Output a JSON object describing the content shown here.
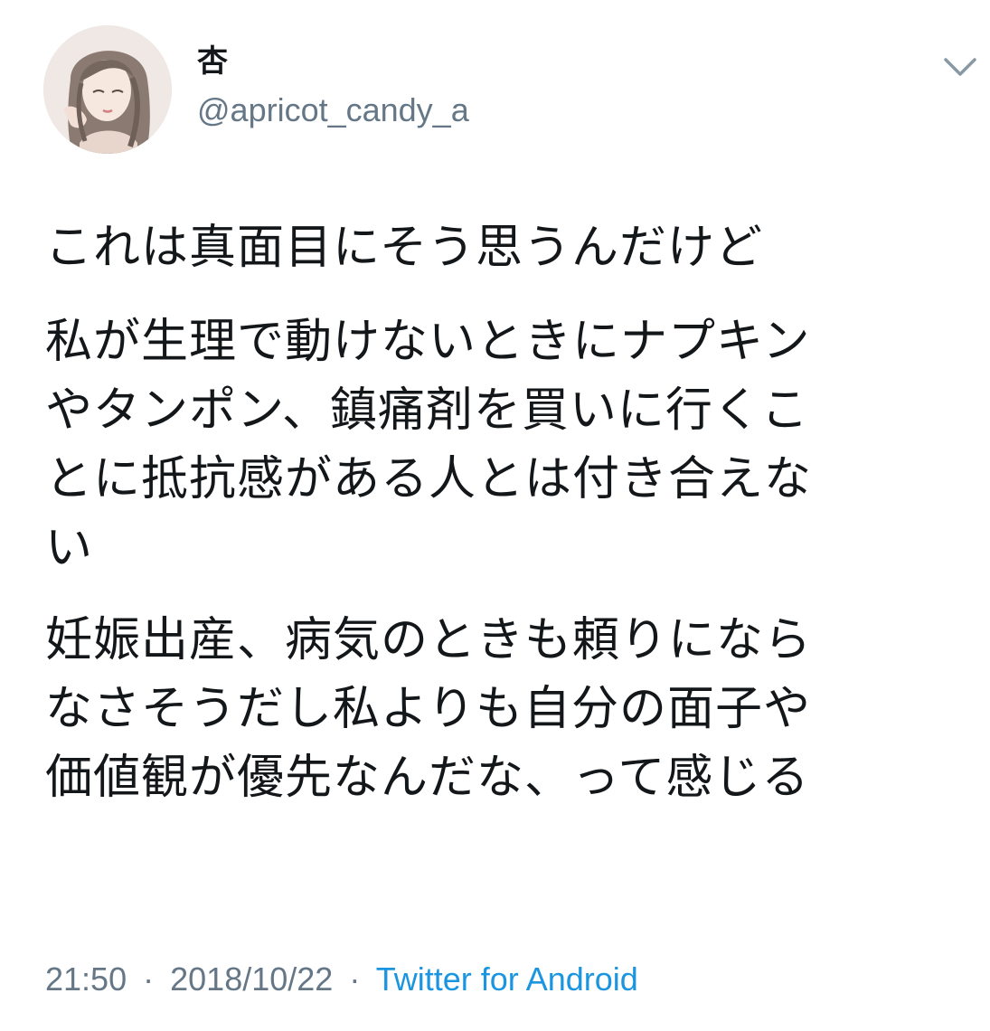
{
  "tweet": {
    "author": {
      "display_name": "杏",
      "handle": "@apricot_candy_a",
      "avatar_icon": "illustrated-girl-avatar"
    },
    "menu_icon": "chevron-down-icon",
    "body": [
      "これは真面目にそう思うんだけど",
      "私が生理で動けないときにナプキン\nやタンポン、鎮痛剤を買いに行くこ\nとに抵抗感がある人とは付き合えな\nい",
      "妊娠出産、病気のときも頼りになら\nなさそうだし私よりも自分の面子や\n価値観が優先なんだな、って感じる"
    ],
    "time": "21:50",
    "date": "2018/10/22",
    "separator": "·",
    "source": "Twitter for Android",
    "colors": {
      "text": "#14171a",
      "secondary": "#657786",
      "link": "#1b95e0"
    }
  }
}
